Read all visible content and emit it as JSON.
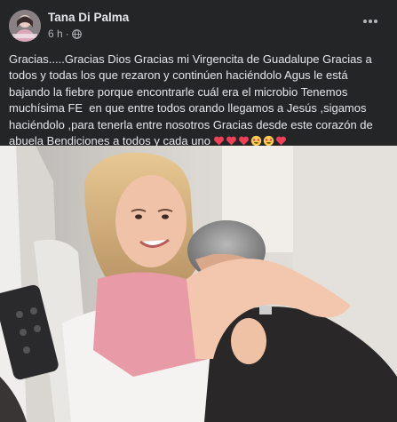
{
  "post": {
    "author": "Tana Di Palma",
    "time": "6 h",
    "separator": "·",
    "privacy_icon": "globe-icon",
    "more_icon": "more-options-icon",
    "text": "Gracias.....Gracias Dios Gracias mi Virgencita de Guadalupe Gracias a todos y todas los que rezaron y continúen haciéndolo Agus le está bajando la fiebre porque encontrarle cuál era el microbio Tenemos  muchísima FE  en que entre todos orando llegamos a Jesús ,sigamos haciéndolo ,para tenerla entre nosotros Gracias desde este corazón de abuela Bendiciones a todos y cada uno",
    "emojis": [
      "red-heart",
      "red-heart",
      "red-heart",
      "star-struck",
      "star-struck",
      "red-heart"
    ],
    "photo": {
      "description_icon": "photo-hospital-hug"
    }
  },
  "colors": {
    "background": "#242526",
    "text_primary": "#e4e6eb",
    "text_secondary": "#b0b3b8",
    "heart": "#f33e58",
    "emoji_yellow": "#ffcc4d"
  }
}
